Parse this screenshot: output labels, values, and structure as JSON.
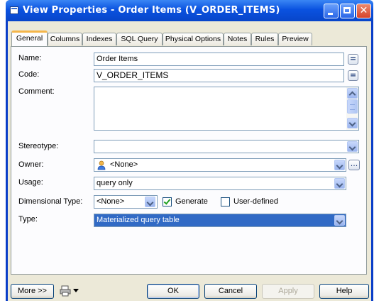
{
  "window": {
    "title": "View Properties - Order Items (V_ORDER_ITEMS)"
  },
  "tabs": [
    "General",
    "Columns",
    "Indexes",
    "SQL Query",
    "Physical Options",
    "Notes",
    "Rules",
    "Preview"
  ],
  "form": {
    "name_label": "Name:",
    "name_value": "Order Items",
    "code_label": "Code:",
    "code_value": "V_ORDER_ITEMS",
    "equal_btn": "=",
    "comment_label": "Comment:",
    "comment_value": "",
    "stereotype_label": "Stereotype:",
    "stereotype_value": "",
    "owner_label": "Owner:",
    "owner_value": "<None>",
    "owner_browse": "...",
    "usage_label": "Usage:",
    "usage_value": "query only",
    "dimtype_label": "Dimensional Type:",
    "dimtype_value": "<None>",
    "generate_label": "Generate",
    "generate_checked": true,
    "userdefined_label": "User-defined",
    "userdefined_checked": false,
    "type_label": "Type:",
    "type_value": "Materialized query table"
  },
  "footer": {
    "more_label": "More >>",
    "ok_label": "OK",
    "cancel_label": "Cancel",
    "apply_label": "Apply",
    "help_label": "Help"
  },
  "icons": {
    "owner": "user-icon",
    "print": "printer-icon",
    "window": "window-icon"
  },
  "colors": {
    "titlebar": "#0a52e0",
    "selection": "#316ac5",
    "active_tab_accent": "#f5b64a",
    "dialog_bg": "#ece9d8"
  }
}
